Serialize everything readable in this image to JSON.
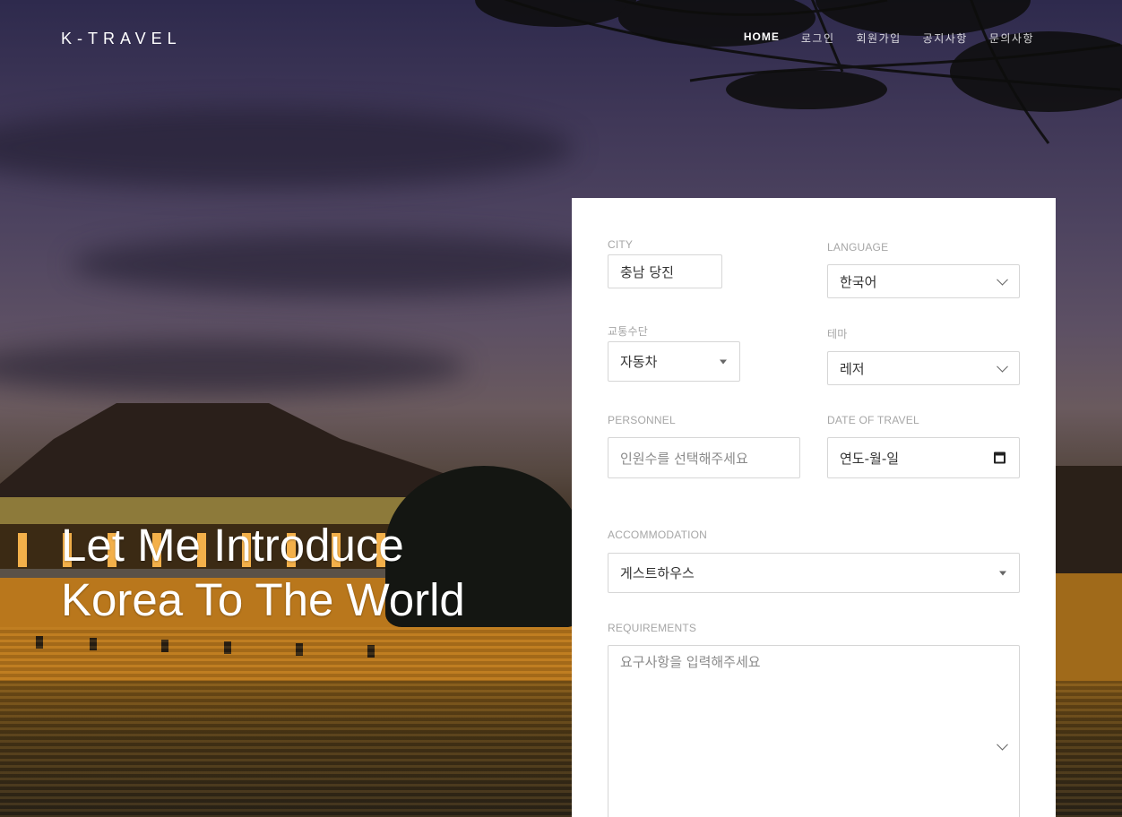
{
  "brand": {
    "logo": "K-TRAVEL"
  },
  "nav": {
    "items": [
      {
        "label": "HOME"
      },
      {
        "label": "로그인"
      },
      {
        "label": "회원가입"
      },
      {
        "label": "공지사항"
      },
      {
        "label": "문의사항"
      }
    ]
  },
  "hero": {
    "line1": "Let Me Introduce",
    "line2": "Korea To The World"
  },
  "form": {
    "city": {
      "label": "CITY",
      "value": "충남 당진"
    },
    "language": {
      "label": "LANGUAGE",
      "value": "한국어"
    },
    "transport": {
      "label": "교통수단",
      "value": "자동차"
    },
    "theme": {
      "label": "테마",
      "value": "레저"
    },
    "personnel": {
      "label": "PERSONNEL",
      "placeholder": "인원수를 선택해주세요"
    },
    "date": {
      "label": "DATE OF TRAVEL",
      "value": "연도-월-일"
    },
    "accommodation": {
      "label": "ACCOMMODATION",
      "value": "게스트하우스"
    },
    "requirements": {
      "label": "REQUIREMENTS",
      "placeholder": "요구사항을 입력해주세요"
    }
  }
}
